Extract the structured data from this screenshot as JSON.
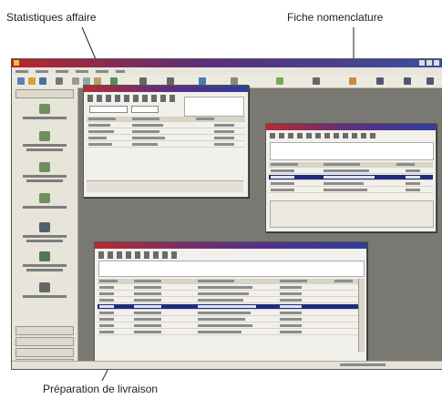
{
  "callouts": {
    "stats": "Statistiques affaire",
    "nomenclature": "Fiche nomenclature",
    "livraison": "Préparation de livraison"
  },
  "colors": {
    "titlebar": "#b8262a",
    "selection": "#1f2a7a",
    "desktop": "#7a7873"
  },
  "icons": [
    "app-icon",
    "toolbar-icons",
    "sidebar-module-icons"
  ]
}
